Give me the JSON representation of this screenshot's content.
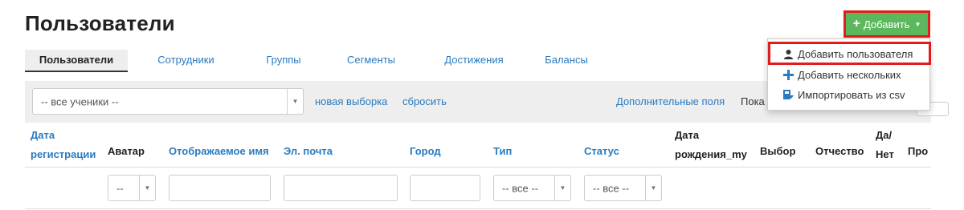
{
  "header": {
    "title": "Пользователи",
    "add_button": "Добавить"
  },
  "dropdown": {
    "items": [
      {
        "label": "Добавить пользователя",
        "icon": "user-icon"
      },
      {
        "label": "Добавить нескольких",
        "icon": "plus-icon"
      },
      {
        "label": "Импортировать из csv",
        "icon": "import-icon"
      }
    ]
  },
  "tabs": [
    {
      "label": "Пользователи",
      "active": true
    },
    {
      "label": "Сотрудники"
    },
    {
      "label": "Группы"
    },
    {
      "label": "Сегменты"
    },
    {
      "label": "Достижения"
    },
    {
      "label": "Балансы"
    }
  ],
  "filter": {
    "select_value": "-- все ученики --",
    "new_selection": "новая выборка",
    "reset": "сбросить",
    "extra_fields": "Дополнительные поля",
    "show_label": "Пока"
  },
  "table": {
    "columns": [
      {
        "line1": "Дата",
        "line2": "регистрации"
      },
      {
        "line2": "Аватар"
      },
      {
        "line2": "Отображаемое имя"
      },
      {
        "line2": "Эл. почта"
      },
      {
        "line2": "Город"
      },
      {
        "line2": "Тип"
      },
      {
        "line2": "Статус"
      },
      {
        "line1": "Дата",
        "line2": "рождения_my"
      },
      {
        "line2": "Выбор"
      },
      {
        "line2": "Отчество"
      },
      {
        "line1": "Да/",
        "line2": "Нет"
      },
      {
        "line2": "Про"
      }
    ],
    "filters": {
      "avatar": "--",
      "type": "-- все --",
      "status": "-- все --"
    }
  },
  "colors": {
    "accent": "#2a7bc0",
    "success": "#5cb85c",
    "highlight": "#e21b1b"
  }
}
